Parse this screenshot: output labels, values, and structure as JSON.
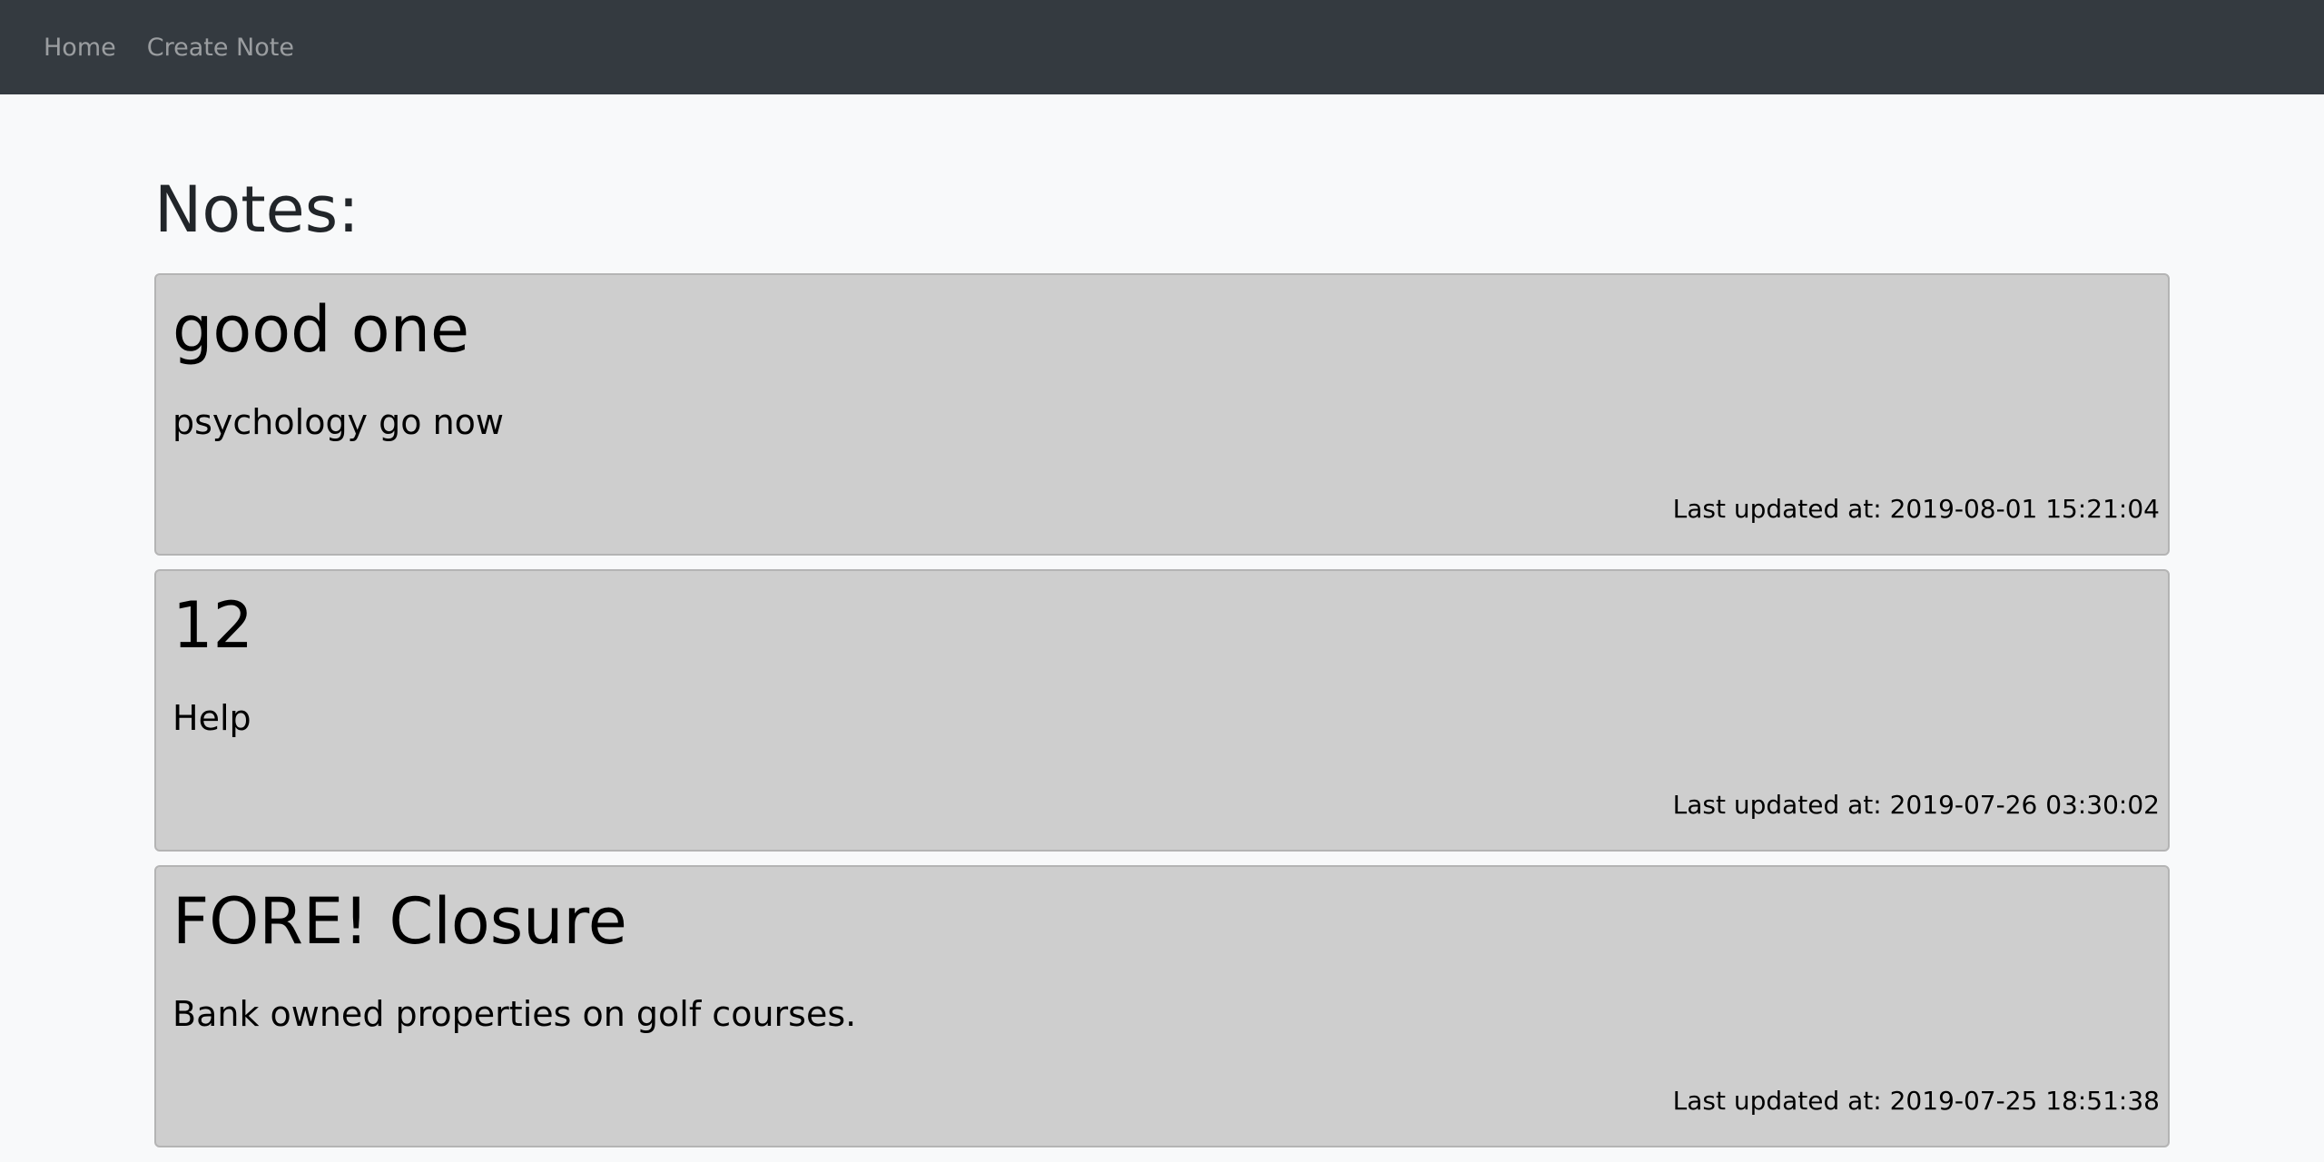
{
  "nav": {
    "items": [
      {
        "label": "Home"
      },
      {
        "label": "Create Note"
      }
    ]
  },
  "page": {
    "title": "Notes:"
  },
  "notes": [
    {
      "title": "good one",
      "body": "psychology go now",
      "updated": "Last updated at: 2019-08-01 15:21:04"
    },
    {
      "title": "12",
      "body": "Help",
      "updated": "Last updated at: 2019-07-26 03:30:02"
    },
    {
      "title": "FORE! Closure",
      "body": "Bank owned properties on golf courses.",
      "updated": "Last updated at: 2019-07-25 18:51:38"
    }
  ],
  "colors": {
    "navbar": "#343a40",
    "page_background": "#f8f9fa",
    "card_background": "#cecece"
  }
}
